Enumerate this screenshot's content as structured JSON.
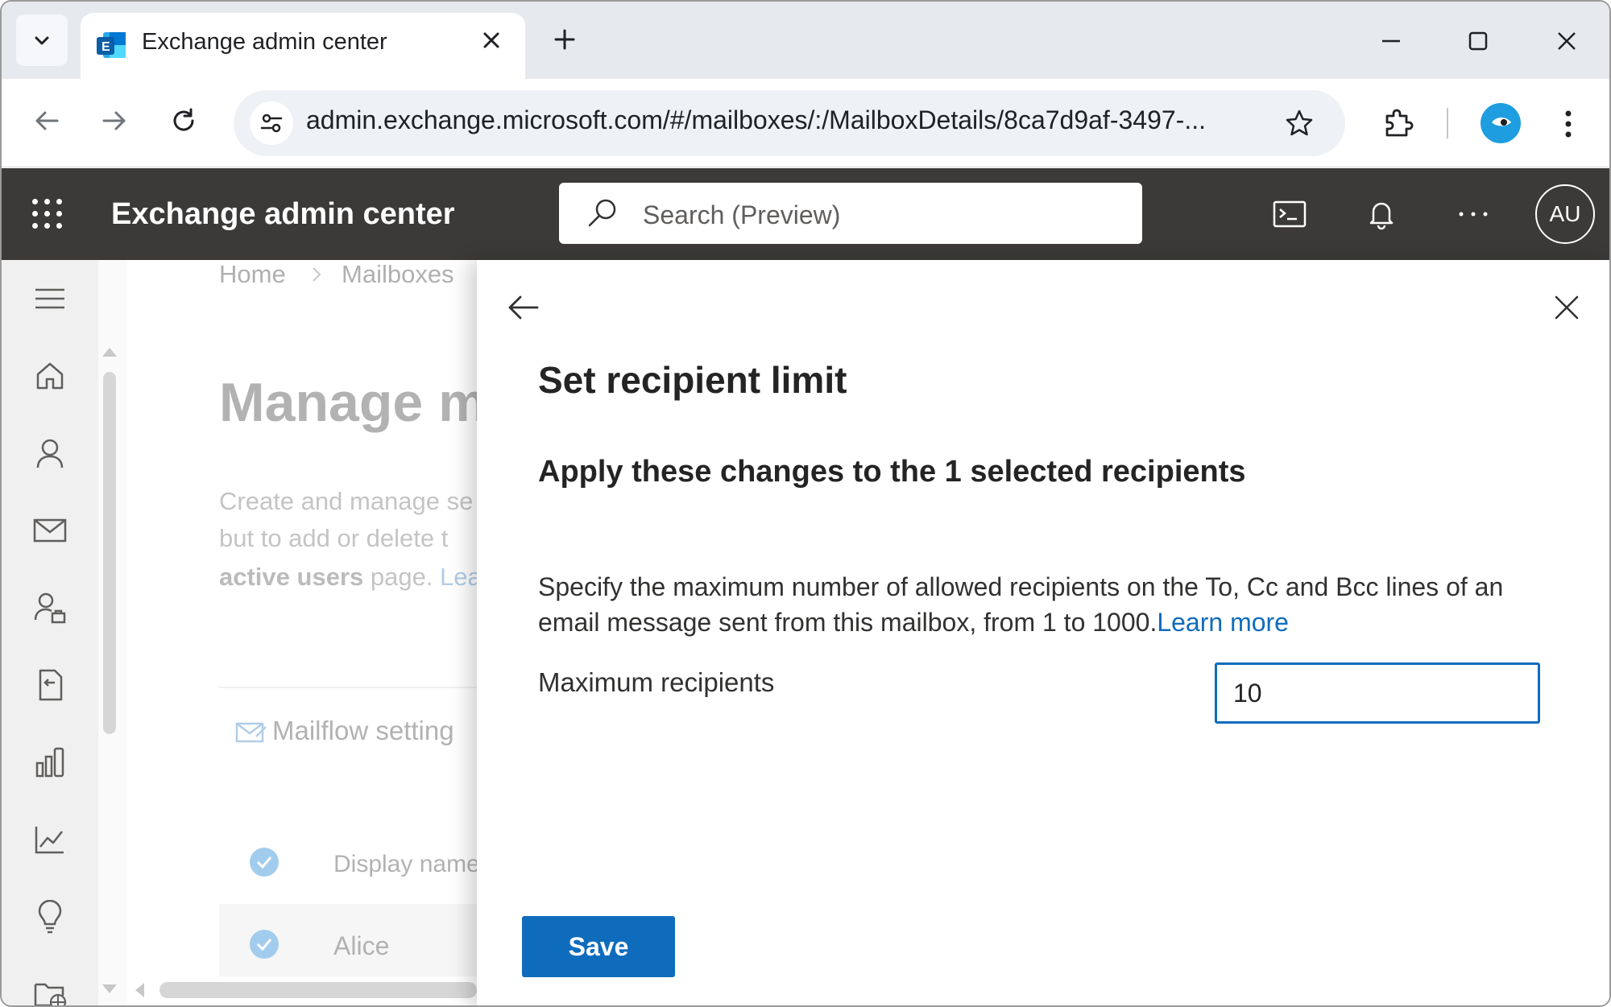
{
  "browser": {
    "tab": {
      "title": "Exchange admin center"
    },
    "url": "admin.exchange.microsoft.com/#/mailboxes/:/MailboxDetails/8ca7d9af-3497-..."
  },
  "app": {
    "title": "Exchange admin center",
    "search_placeholder": "Search (Preview)",
    "avatar_initials": "AU"
  },
  "background_page": {
    "breadcrumb": {
      "home": "Home",
      "current": "Mailboxes"
    },
    "title": "Manage m",
    "desc_line1": "Create and manage se",
    "desc_line2": "but to add or delete t",
    "desc_line3_bold": "active users",
    "desc_line3_rest": " page. ",
    "desc_line3_link": "Lea",
    "mailflow": "Mailflow setting",
    "column_display_name": "Display name",
    "row_name": "Alice"
  },
  "panel": {
    "title": "Set recipient limit",
    "subtitle": "Apply these changes to the 1 selected recipients",
    "description": "Specify the maximum number of allowed recipients on the To, Cc and Bcc lines of an email message sent from this mailbox, from 1 to 1000.",
    "learn_more": "Learn more",
    "field_label": "Maximum recipients",
    "field_value": "10",
    "save_label": "Save"
  },
  "colors": {
    "accent": "#0f6cbd",
    "appbar": "#3b3a39",
    "check": "#5fa7e0"
  }
}
